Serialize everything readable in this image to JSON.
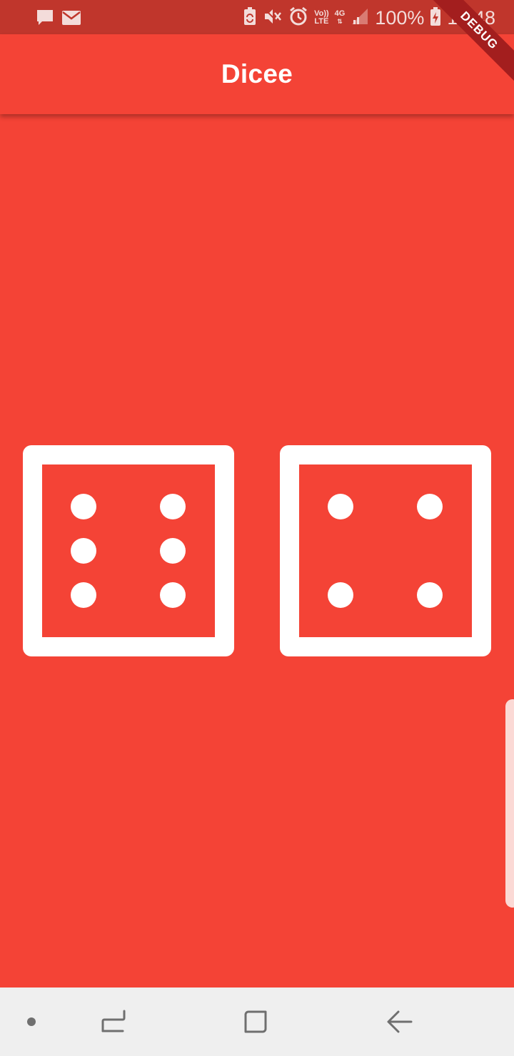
{
  "status_bar": {
    "icons": [
      "chat-icon",
      "mail-icon",
      "battery-saver-icon",
      "mute-icon",
      "alarm-icon",
      "volte-icon",
      "network-4g-icon",
      "signal-icon",
      "battery-charging-icon"
    ],
    "volte_label_top": "Vo))",
    "volte_label_bottom": "LTE",
    "network_label": "4G",
    "battery": "100%",
    "time": "18:48"
  },
  "debug_banner": "DEBUG",
  "app_bar": {
    "title": "Dicee"
  },
  "dice": {
    "left_value": 6,
    "right_value": 4
  },
  "colors": {
    "background": "#F44336",
    "status_bar": "#C0362C",
    "die": "#FFFFFF",
    "nav_bar": "#EFEFEF"
  },
  "nav_bar": {
    "icons": [
      "dot-icon",
      "recent-apps-icon",
      "home-icon",
      "back-icon"
    ]
  }
}
